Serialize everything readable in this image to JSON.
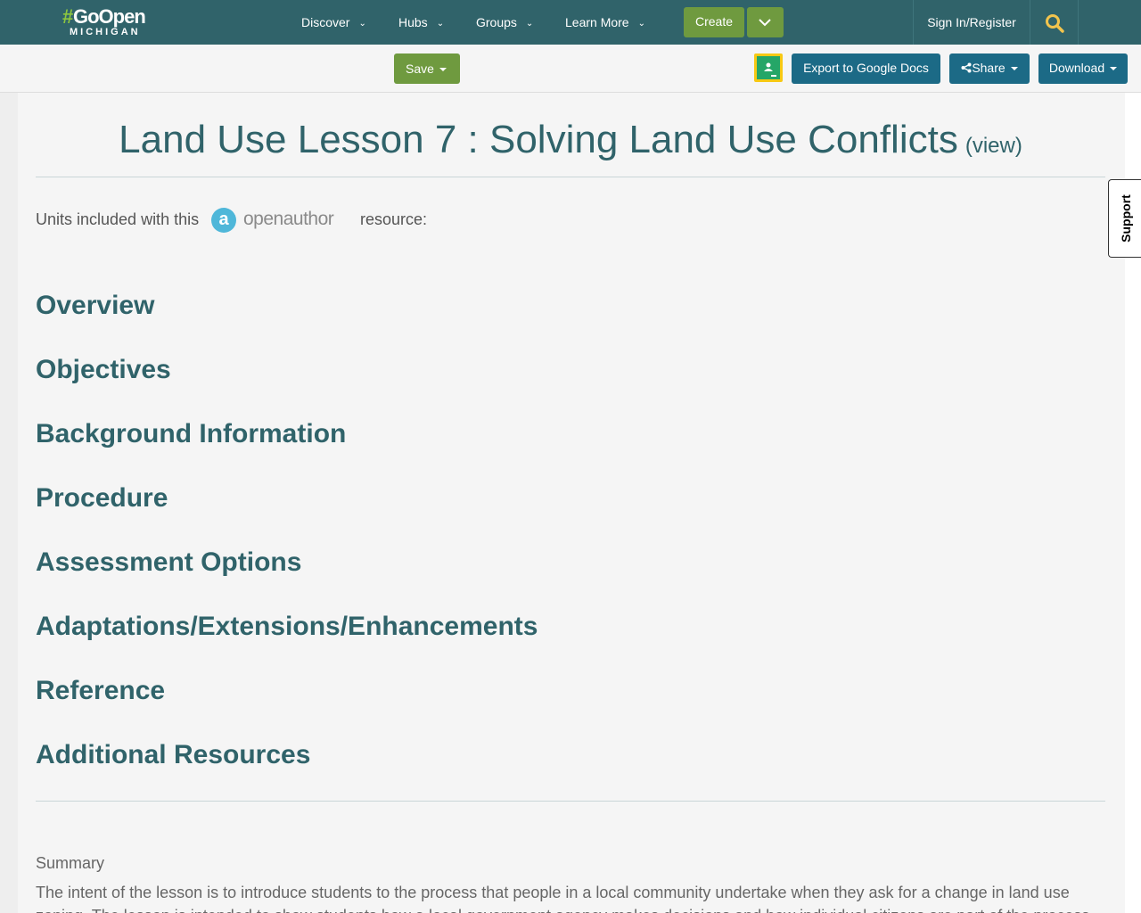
{
  "header": {
    "logo_hash": "#",
    "logo_top": "GoOpen",
    "logo_bottom": "MICHIGAN",
    "nav": [
      "Discover",
      "Hubs",
      "Groups",
      "Learn More"
    ],
    "create_label": "Create",
    "signin_label": "Sign In/Register",
    "accent": "#30636a",
    "green": "#6f9a3f",
    "search_icon_color": "#f2c44d"
  },
  "toolbar": {
    "save_label": "Save",
    "export_label": "Export to Google Docs",
    "share_label": "Share",
    "download_label": "Download",
    "button_blue": "#1c6a86"
  },
  "main": {
    "title": "Land Use Lesson 7 : Solving Land Use Conflicts",
    "view_link": "(view)",
    "units_before": "Units included with this",
    "units_after": "resource:",
    "openauthor_logo": "openauthor",
    "sections": [
      "Overview",
      "Objectives",
      "Background Information",
      "Procedure",
      "Assessment Options",
      "Adaptations/Extensions/Enhancements",
      "Reference",
      "Additional Resources"
    ],
    "summary_label": "Summary",
    "summary_text": "The intent of the lesson is to introduce students to the process that people in a local community undertake when they ask for a change in land use zoning. The lesson is intended to show students how a local government agency makes decisions and how individual citizens are part of the process."
  },
  "support_tab": "Support"
}
